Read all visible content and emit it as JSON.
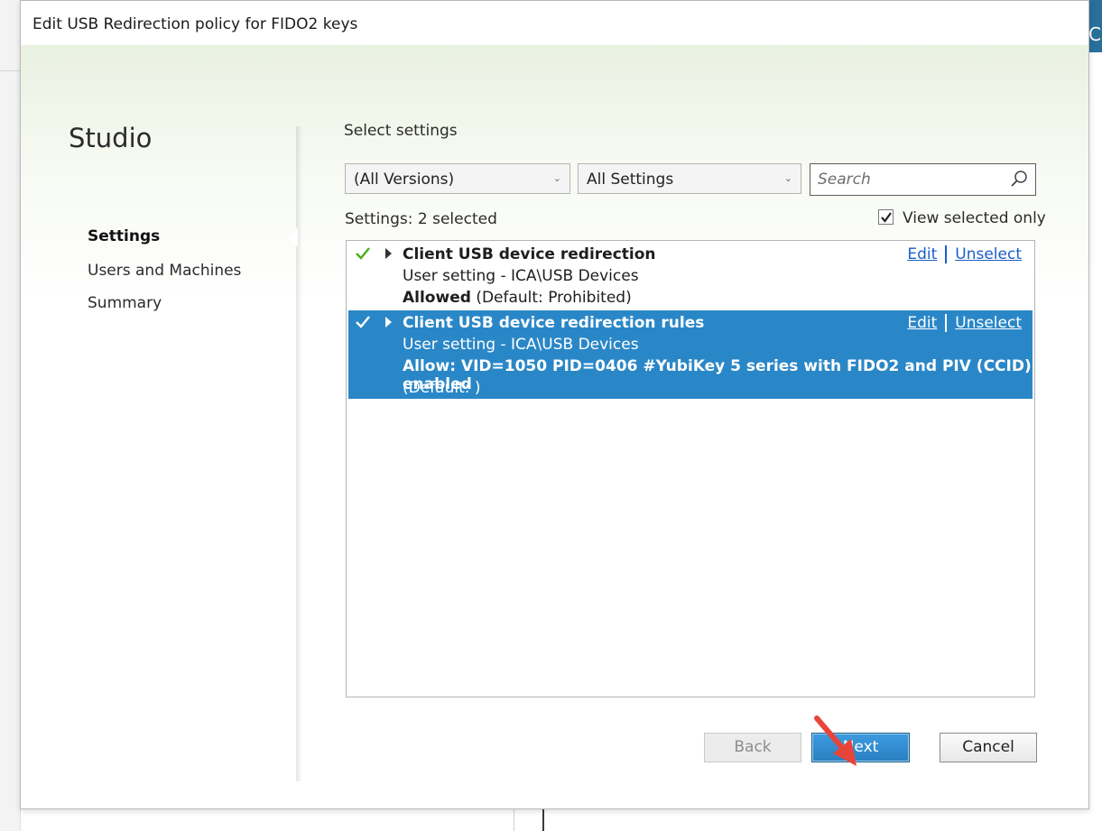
{
  "window": {
    "title": "Edit USB Redirection policy for FIDO2 keys"
  },
  "background": {
    "partial_text": "C"
  },
  "sidebar": {
    "brand": "Studio",
    "items": [
      {
        "label": "Settings",
        "active": true
      },
      {
        "label": "Users and Machines",
        "active": false
      },
      {
        "label": "Summary",
        "active": false
      }
    ]
  },
  "main": {
    "section_label": "Select settings",
    "filters": {
      "version": "(All Versions)",
      "category": "All Settings",
      "search_placeholder": "Search"
    },
    "settings_count_label": "Settings:",
    "settings_count_value": "2 selected",
    "view_selected_label": "View selected only",
    "view_selected_checked": true,
    "settings": [
      {
        "name": "Client USB device redirection",
        "path": "User setting - ICA\\USB Devices",
        "value": "Allowed",
        "default": "(Default: Prohibited)",
        "edit": "Edit",
        "unselect": "Unselect",
        "selected": false
      },
      {
        "name": "Client USB device redirection rules",
        "path": "User setting - ICA\\USB Devices",
        "value": "Allow: VID=1050 PID=0406 #YubiKey 5 series with FIDO2 and PIV (CCID) enabled",
        "default": "(Default: )",
        "edit": "Edit",
        "unselect": "Unselect",
        "selected": true
      }
    ]
  },
  "footer": {
    "back": "Back",
    "next": "Next",
    "cancel": "Cancel"
  },
  "colors": {
    "selection": "#2a87c7",
    "link": "#1a5fc8",
    "check_green": "#4caf1a",
    "annotation_arrow": "#e8443a"
  },
  "icons": {
    "search": "search-icon",
    "check": "check-icon",
    "expand": "expand-arrow-icon",
    "dropdown": "chevron-down-icon"
  }
}
